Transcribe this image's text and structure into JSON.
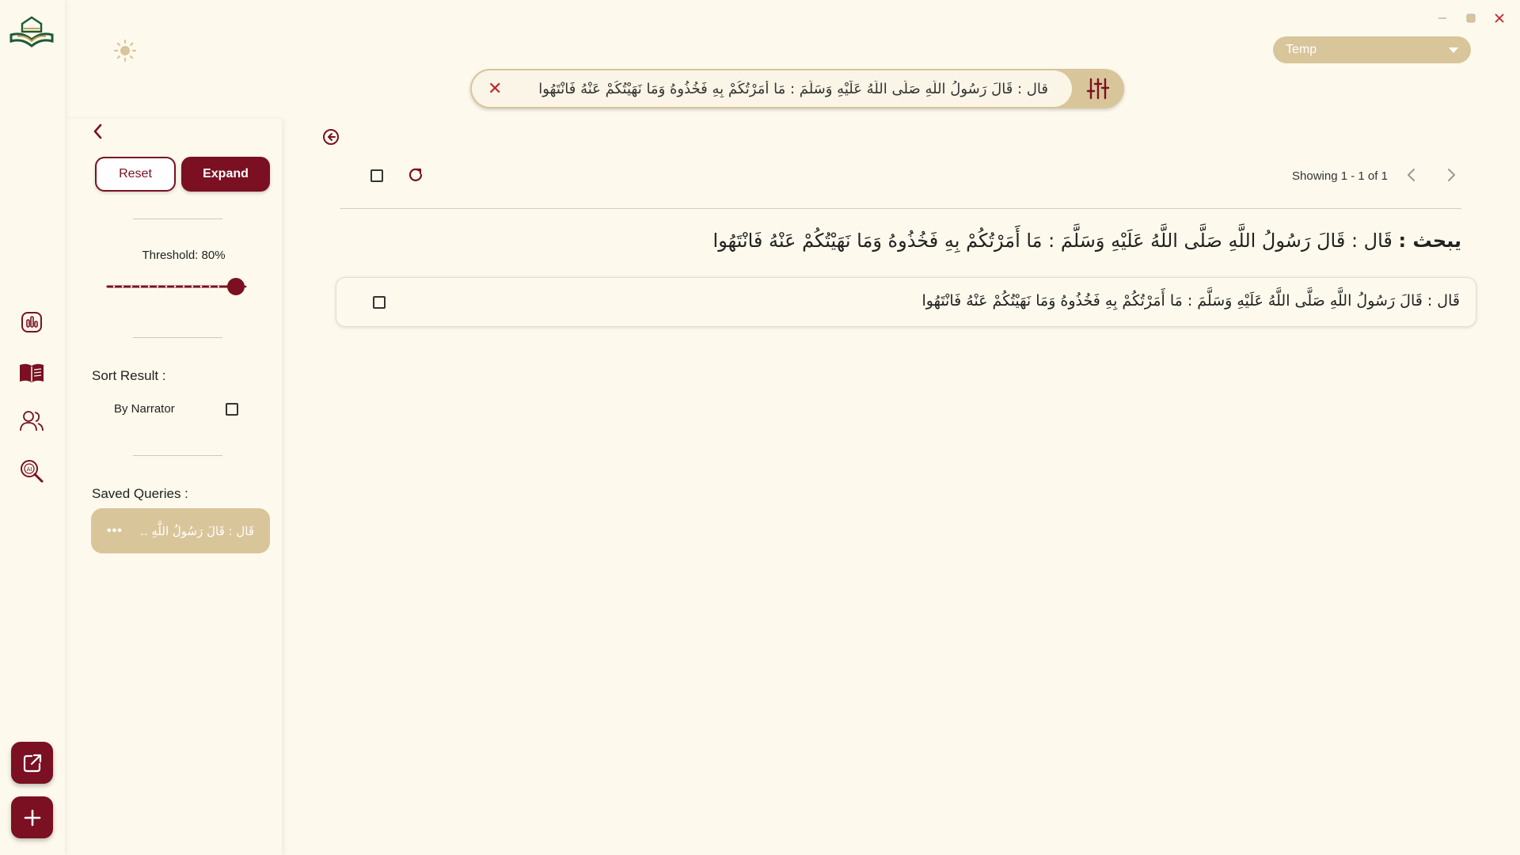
{
  "app": {
    "colors": {
      "accent": "#7a1022",
      "gold": "#d9c59a",
      "background": "#fdfaed"
    }
  },
  "header": {
    "dropdown_value": "Temp"
  },
  "search": {
    "query": "قال : قَالَ رَسُولُ اللَّهِ صَلَّى اللَّهُ عَلَيْهِ وَسَلَّمَ : مَا أَمَرْتُكُمْ بِهِ فَخُذُوهُ وَمَا نَهَيْتُكُمْ عَنْهُ فَانْتَهُوا",
    "clear_icon": "close-icon",
    "filter_icon": "sliders-icon"
  },
  "sidebar_panel": {
    "reset_label": "Reset",
    "expand_label": "Expand",
    "threshold_label": "Threshold: 80%",
    "threshold_value": 0.8,
    "sort_label": "Sort Result :",
    "by_narrator_label": "By Narrator",
    "by_narrator_checked": false,
    "saved_queries_label": "Saved Queries :",
    "saved_queries": [
      {
        "text": "قَال : قَالَ رَسُولُ اللَّهِ ..",
        "menu": "•••"
      }
    ]
  },
  "results": {
    "showing_text": "Showing 1 - 1 of 1",
    "heading_prefix": "يبحث :",
    "heading_query": "قَال : قَالَ رَسُولُ اللَّهِ صَلَّى اللَّهُ عَلَيْهِ وَسَلَّمَ : مَا أَمَرْتُكُمْ بِهِ فَخُذُوهُ وَمَا نَهَيْتُكُمْ عَنْهُ فَانْتَهُوا",
    "items": [
      {
        "text": "قَال : قَالَ رَسُولُ اللَّهِ صَلَّى اللَّهُ عَلَيْهِ وَسَلَّمَ : مَا أَمَرْتُكُمْ بِهِ فَخُذُوهُ وَمَا نَهَيْتُكُمْ عَنْهُ فَانْتَهُوا",
        "checked": false
      }
    ]
  },
  "rail": {
    "icons": [
      "logo-icon",
      "stats-icon",
      "book-icon",
      "users-icon",
      "ai-search-icon",
      "external-link-icon",
      "plus-icon"
    ]
  }
}
